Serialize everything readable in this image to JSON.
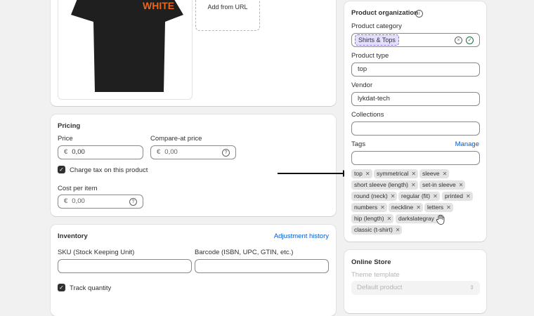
{
  "media": {
    "add_from_url": "Add from URL",
    "shirt_print": "WHITE"
  },
  "pricing": {
    "title": "Pricing",
    "price_label": "Price",
    "price_prefix": "€",
    "price_value": "0,00",
    "compare_label": "Compare-at price",
    "compare_prefix": "€",
    "compare_placeholder": "0,00",
    "charge_tax_label": "Charge tax on this product",
    "cost_label": "Cost per item",
    "cost_prefix": "€",
    "cost_placeholder": "0,00"
  },
  "inventory": {
    "title": "Inventory",
    "adjustment_link": "Adjustment history",
    "sku_label": "SKU (Stock Keeping Unit)",
    "barcode_label": "Barcode (ISBN, UPC, GTIN, etc.)",
    "track_quantity_label": "Track quantity"
  },
  "organization": {
    "title": "Product organization",
    "category_label": "Product category",
    "category_value": "Shirts & Tops",
    "type_label": "Product type",
    "type_value": "top",
    "vendor_label": "Vendor",
    "vendor_value": "lykdat-tech",
    "collections_label": "Collections",
    "tags_label": "Tags",
    "tags_manage": "Manage",
    "tags": [
      "top",
      "symmetrical",
      "sleeve",
      "short sleeve (length)",
      "set-in sleeve",
      "round (neck)",
      "regular (fit)",
      "printed",
      "numbers",
      "neckline",
      "letters",
      "hip (length)",
      "darkslategray",
      "classic (t-shirt)"
    ]
  },
  "online_store": {
    "title": "Online Store",
    "theme_label": "Theme template",
    "theme_value": "Default product"
  },
  "colors": {
    "accent": "#005bd3",
    "category_chip_bg": "#e4deff",
    "category_chip_border": "#8a6cf0"
  }
}
